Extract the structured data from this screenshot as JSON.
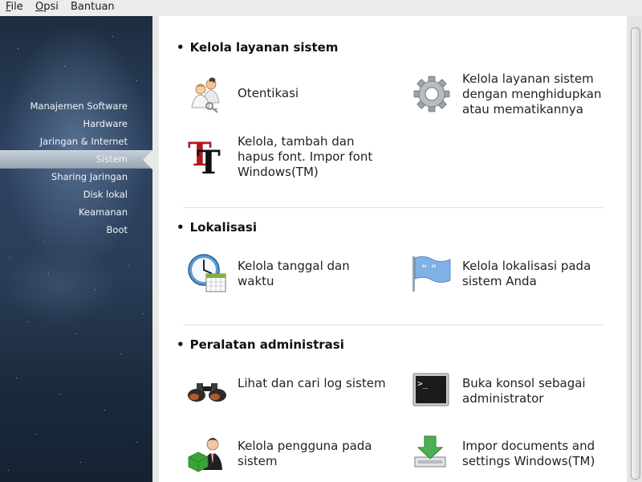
{
  "menubar": {
    "file": {
      "mnemonic": "F",
      "rest": "ile"
    },
    "opsi": {
      "mnemonic": "O",
      "rest": "psi"
    },
    "bantuan": {
      "label": "Bantuan"
    }
  },
  "sidebar": {
    "items": [
      {
        "label": "Manajemen Software"
      },
      {
        "label": "Hardware"
      },
      {
        "label": "Jaringan & Internet"
      },
      {
        "label": "Sistem",
        "selected": true
      },
      {
        "label": "Sharing Jaringan"
      },
      {
        "label": "Disk lokal"
      },
      {
        "label": "Keamanan"
      },
      {
        "label": "Boot"
      }
    ]
  },
  "sections": [
    {
      "title": "Kelola layanan sistem",
      "tools": [
        {
          "label": "Otentikasi",
          "icon": "users-key-icon"
        },
        {
          "label": "Kelola layanan sistem dengan menghidupkan atau mematikannya",
          "icon": "gear-icon"
        },
        {
          "label": "Kelola, tambah dan hapus font. Impor font Windows(TM)",
          "icon": "font-icon"
        }
      ]
    },
    {
      "title": "Lokalisasi",
      "tools": [
        {
          "label": "Kelola tanggal dan waktu",
          "icon": "clock-calendar-icon"
        },
        {
          "label": "Kelola lokalisasi pada sistem Anda",
          "icon": "flag-icon"
        }
      ]
    },
    {
      "title": "Peralatan administrasi",
      "tools": [
        {
          "label": "Lihat dan cari log sistem",
          "icon": "binoculars-icon"
        },
        {
          "label": "Buka konsol sebagai administrator",
          "icon": "terminal-icon"
        },
        {
          "label": "Kelola pengguna pada sistem",
          "icon": "user-manager-icon"
        },
        {
          "label": "Impor documents and settings Windows(TM)",
          "icon": "import-icon"
        }
      ]
    }
  ],
  "colors": {
    "sidebar_top": "#1d2c40",
    "sidebar_mid": "#2d4361",
    "selected_item": "#9aa7b6",
    "content_bg": "#ffffff",
    "window_bg": "#e8e8e7"
  }
}
